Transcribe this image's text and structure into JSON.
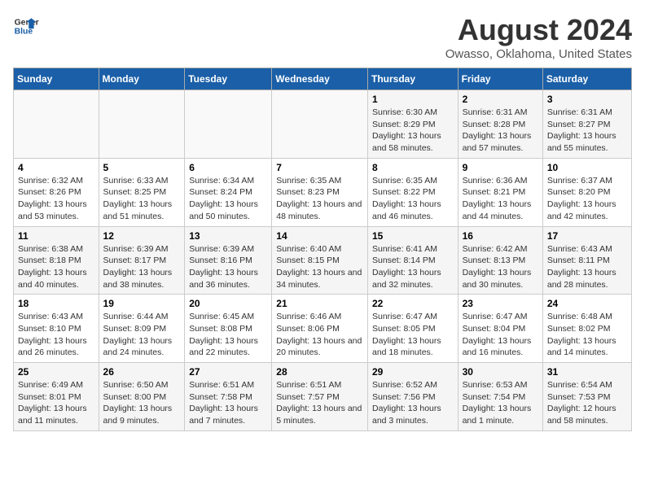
{
  "header": {
    "logo_line1": "General",
    "logo_line2": "Blue",
    "title": "August 2024",
    "subtitle": "Owasso, Oklahoma, United States"
  },
  "weekdays": [
    "Sunday",
    "Monday",
    "Tuesday",
    "Wednesday",
    "Thursday",
    "Friday",
    "Saturday"
  ],
  "weeks": [
    [
      {
        "day": "",
        "info": ""
      },
      {
        "day": "",
        "info": ""
      },
      {
        "day": "",
        "info": ""
      },
      {
        "day": "",
        "info": ""
      },
      {
        "day": "1",
        "info": "Sunrise: 6:30 AM\nSunset: 8:29 PM\nDaylight: 13 hours and 58 minutes."
      },
      {
        "day": "2",
        "info": "Sunrise: 6:31 AM\nSunset: 8:28 PM\nDaylight: 13 hours and 57 minutes."
      },
      {
        "day": "3",
        "info": "Sunrise: 6:31 AM\nSunset: 8:27 PM\nDaylight: 13 hours and 55 minutes."
      }
    ],
    [
      {
        "day": "4",
        "info": "Sunrise: 6:32 AM\nSunset: 8:26 PM\nDaylight: 13 hours and 53 minutes."
      },
      {
        "day": "5",
        "info": "Sunrise: 6:33 AM\nSunset: 8:25 PM\nDaylight: 13 hours and 51 minutes."
      },
      {
        "day": "6",
        "info": "Sunrise: 6:34 AM\nSunset: 8:24 PM\nDaylight: 13 hours and 50 minutes."
      },
      {
        "day": "7",
        "info": "Sunrise: 6:35 AM\nSunset: 8:23 PM\nDaylight: 13 hours and 48 minutes."
      },
      {
        "day": "8",
        "info": "Sunrise: 6:35 AM\nSunset: 8:22 PM\nDaylight: 13 hours and 46 minutes."
      },
      {
        "day": "9",
        "info": "Sunrise: 6:36 AM\nSunset: 8:21 PM\nDaylight: 13 hours and 44 minutes."
      },
      {
        "day": "10",
        "info": "Sunrise: 6:37 AM\nSunset: 8:20 PM\nDaylight: 13 hours and 42 minutes."
      }
    ],
    [
      {
        "day": "11",
        "info": "Sunrise: 6:38 AM\nSunset: 8:18 PM\nDaylight: 13 hours and 40 minutes."
      },
      {
        "day": "12",
        "info": "Sunrise: 6:39 AM\nSunset: 8:17 PM\nDaylight: 13 hours and 38 minutes."
      },
      {
        "day": "13",
        "info": "Sunrise: 6:39 AM\nSunset: 8:16 PM\nDaylight: 13 hours and 36 minutes."
      },
      {
        "day": "14",
        "info": "Sunrise: 6:40 AM\nSunset: 8:15 PM\nDaylight: 13 hours and 34 minutes."
      },
      {
        "day": "15",
        "info": "Sunrise: 6:41 AM\nSunset: 8:14 PM\nDaylight: 13 hours and 32 minutes."
      },
      {
        "day": "16",
        "info": "Sunrise: 6:42 AM\nSunset: 8:13 PM\nDaylight: 13 hours and 30 minutes."
      },
      {
        "day": "17",
        "info": "Sunrise: 6:43 AM\nSunset: 8:11 PM\nDaylight: 13 hours and 28 minutes."
      }
    ],
    [
      {
        "day": "18",
        "info": "Sunrise: 6:43 AM\nSunset: 8:10 PM\nDaylight: 13 hours and 26 minutes."
      },
      {
        "day": "19",
        "info": "Sunrise: 6:44 AM\nSunset: 8:09 PM\nDaylight: 13 hours and 24 minutes."
      },
      {
        "day": "20",
        "info": "Sunrise: 6:45 AM\nSunset: 8:08 PM\nDaylight: 13 hours and 22 minutes."
      },
      {
        "day": "21",
        "info": "Sunrise: 6:46 AM\nSunset: 8:06 PM\nDaylight: 13 hours and 20 minutes."
      },
      {
        "day": "22",
        "info": "Sunrise: 6:47 AM\nSunset: 8:05 PM\nDaylight: 13 hours and 18 minutes."
      },
      {
        "day": "23",
        "info": "Sunrise: 6:47 AM\nSunset: 8:04 PM\nDaylight: 13 hours and 16 minutes."
      },
      {
        "day": "24",
        "info": "Sunrise: 6:48 AM\nSunset: 8:02 PM\nDaylight: 13 hours and 14 minutes."
      }
    ],
    [
      {
        "day": "25",
        "info": "Sunrise: 6:49 AM\nSunset: 8:01 PM\nDaylight: 13 hours and 11 minutes."
      },
      {
        "day": "26",
        "info": "Sunrise: 6:50 AM\nSunset: 8:00 PM\nDaylight: 13 hours and 9 minutes."
      },
      {
        "day": "27",
        "info": "Sunrise: 6:51 AM\nSunset: 7:58 PM\nDaylight: 13 hours and 7 minutes."
      },
      {
        "day": "28",
        "info": "Sunrise: 6:51 AM\nSunset: 7:57 PM\nDaylight: 13 hours and 5 minutes."
      },
      {
        "day": "29",
        "info": "Sunrise: 6:52 AM\nSunset: 7:56 PM\nDaylight: 13 hours and 3 minutes."
      },
      {
        "day": "30",
        "info": "Sunrise: 6:53 AM\nSunset: 7:54 PM\nDaylight: 13 hours and 1 minute."
      },
      {
        "day": "31",
        "info": "Sunrise: 6:54 AM\nSunset: 7:53 PM\nDaylight: 12 hours and 58 minutes."
      }
    ]
  ]
}
